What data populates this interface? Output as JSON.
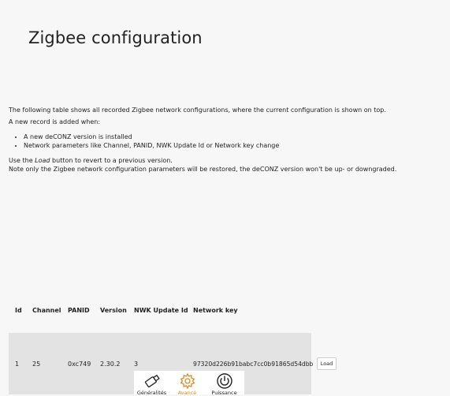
{
  "page": {
    "title": "Zigbee configuration"
  },
  "description": {
    "intro": "The following table shows all recorded Zigbee network configurations, where the current configuration is shown on top.",
    "new_record": "A new record is added when:",
    "bullets": [
      "A new deCONZ version is installed",
      "Network parameters like Channel, PANID, NWK Update Id or Network key change"
    ],
    "revert_prefix": "Use the ",
    "revert_em": "Load",
    "revert_suffix": " button to revert to a previous version.",
    "note": "Note only the Zigbee network configuration parameters will be restored, the deCONZ version won't be up- or downgraded."
  },
  "table": {
    "headers": [
      "Id",
      "Channel",
      "PANID",
      "Version",
      "NWK Update Id",
      "Network key"
    ],
    "rows": [
      [
        "1",
        "25",
        "0xc749",
        "2.30.2",
        "3",
        "97320d226b91babc7cc0b91865d54dbb"
      ]
    ],
    "load_label": "Load"
  },
  "tabbar": {
    "items": [
      {
        "label": "Généralités",
        "icon": "usb-stick-icon"
      },
      {
        "label": "Avancé",
        "icon": "gear-icon",
        "active": true
      },
      {
        "label": "Puissance",
        "icon": "power-icon"
      }
    ],
    "active_color": "#d98b2b"
  }
}
